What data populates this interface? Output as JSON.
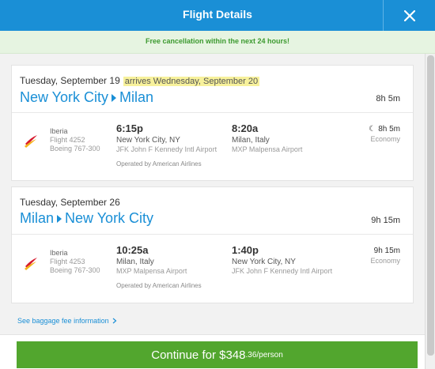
{
  "header": {
    "title": "Flight Details"
  },
  "banner": {
    "text": "Free cancellation within the next 24 hours!"
  },
  "trips": [
    {
      "date": "Tuesday, September 19",
      "arrives_note": "arrives Wednesday, September 20",
      "origin": "New York City",
      "destination": "Milan",
      "duration": "8h 5m",
      "flight": {
        "airline": "Iberia",
        "flight_no": "Flight 4252",
        "aircraft": "Boeing 767-300",
        "depart_time": "6:15p",
        "depart_city": "New York City, NY",
        "depart_airport": "JFK John F Kennedy Intl Airport",
        "arrive_time": "8:20a",
        "arrive_city": "Milan, Italy",
        "arrive_airport": "MXP Malpensa Airport",
        "operated_by": "Operated by American Airlines",
        "leg_duration": "8h 5m",
        "cabin": "Economy",
        "overnight": true
      }
    },
    {
      "date": "Tuesday, September 26",
      "arrives_note": "",
      "origin": "Milan",
      "destination": "New York City",
      "duration": "9h 15m",
      "flight": {
        "airline": "Iberia",
        "flight_no": "Flight 4253",
        "aircraft": "Boeing 767-300",
        "depart_time": "10:25a",
        "depart_city": "Milan, Italy",
        "depart_airport": "MXP Malpensa Airport",
        "arrive_time": "1:40p",
        "arrive_city": "New York City, NY",
        "arrive_airport": "JFK John F Kennedy Intl Airport",
        "operated_by": "Operated by American Airlines",
        "leg_duration": "9h 15m",
        "cabin": "Economy",
        "overnight": false
      }
    }
  ],
  "baggage_link": "See baggage fee information",
  "continue": {
    "label": "Continue for $348",
    "cents": ".36/person"
  },
  "colors": {
    "accent": "#1a8fd6",
    "success": "#52a62e",
    "highlight": "#f7f19b"
  },
  "icons": {
    "close": "close-icon",
    "moon": "moon-icon",
    "chevron": "chevron-right-icon"
  }
}
